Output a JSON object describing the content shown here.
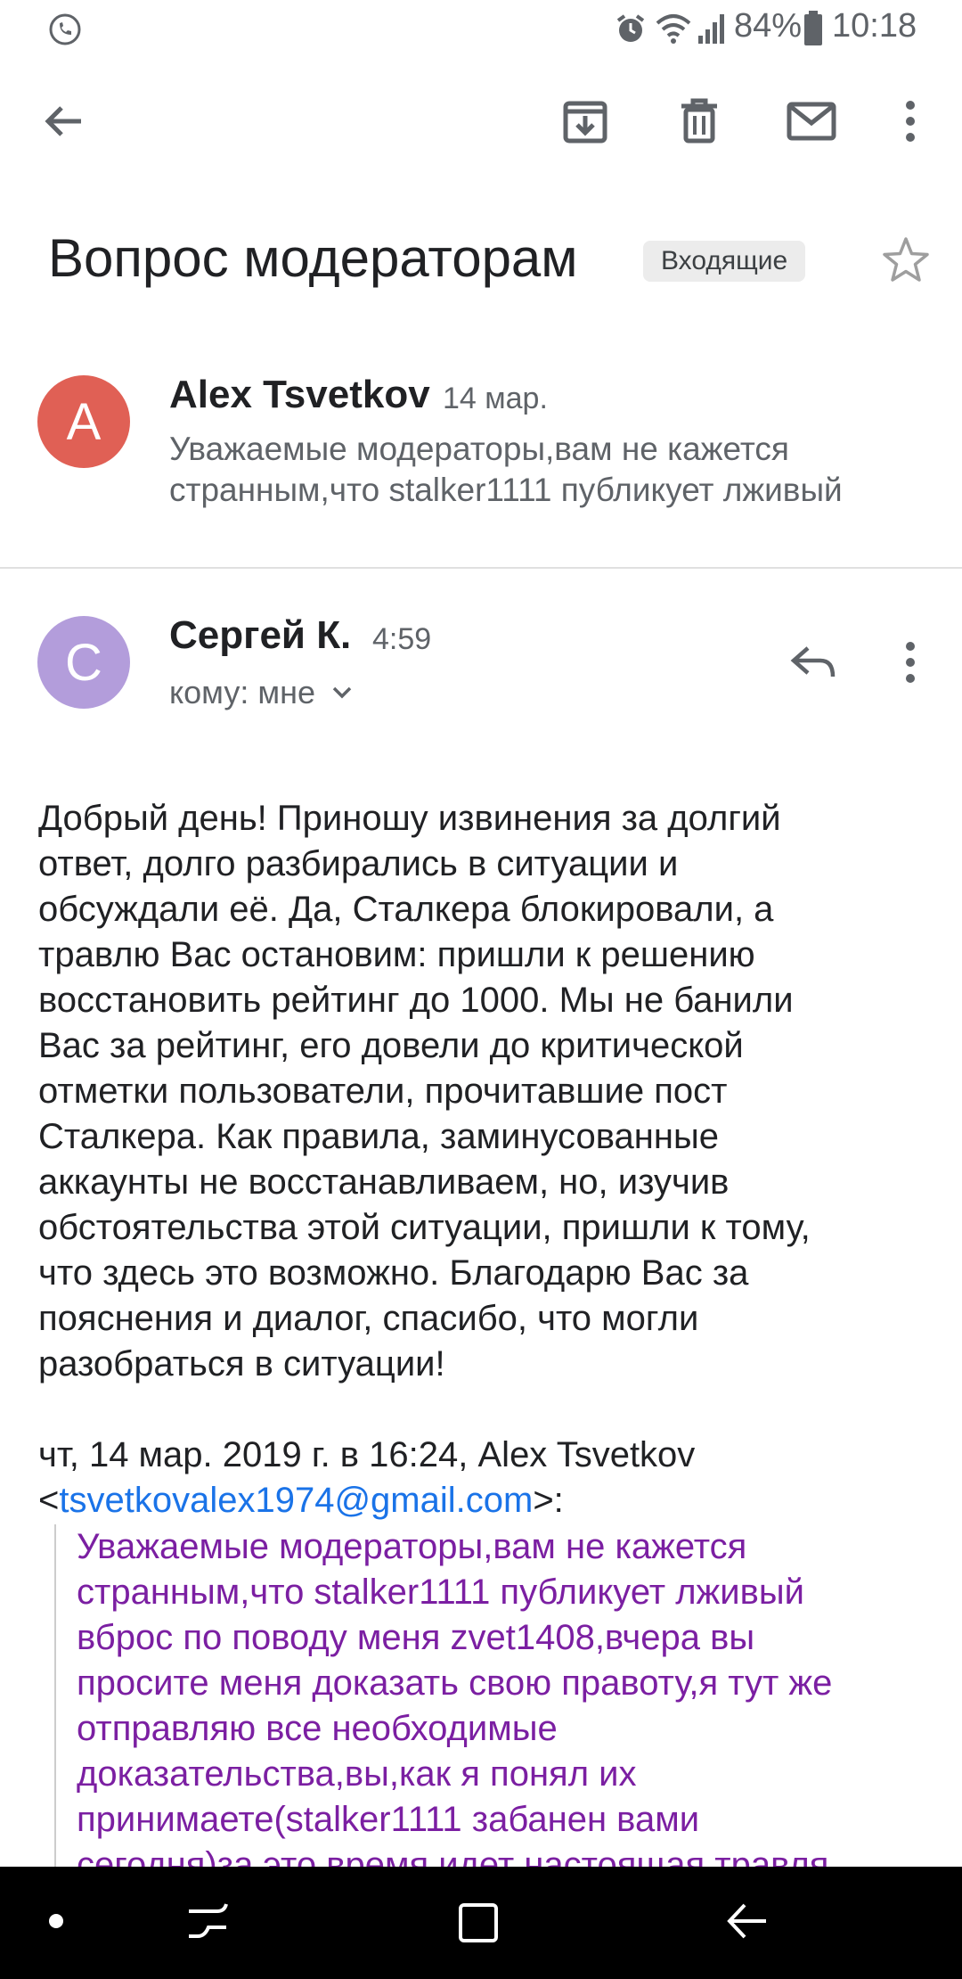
{
  "status_bar": {
    "battery": "84%",
    "time": "10:18",
    "icons": [
      "phone-call-icon",
      "alarm-icon",
      "wifi-icon",
      "signal-icon",
      "battery-icon"
    ]
  },
  "app_bar": {
    "icons": [
      "back-arrow-icon",
      "archive-icon",
      "delete-icon",
      "mark-unread-icon",
      "more-vert-icon"
    ]
  },
  "subject": {
    "title": "Вопрос модераторам",
    "label": "Входящие"
  },
  "collapsed_message": {
    "avatar_letter": "A",
    "avatar_color": "#e06055",
    "sender": "Alex Tsvetkov",
    "date": "14 мар.",
    "snippet_line1": "Уважаемые модераторы,вам не кажется",
    "snippet_line2": "странным,что stalker1111 публикует лживый"
  },
  "open_message": {
    "avatar_letter": "С",
    "avatar_color": "#b39ddb",
    "sender": "Сергей К.",
    "time": "4:59",
    "recipient": "кому: мне",
    "body_lines": [
      "Добрый день! Приношу извинения за долгий",
      "ответ, долго разбирались в ситуации и",
      "обсуждали её.  Да, Сталкера блокировали, а",
      "травлю Вас остановим: пришли к решению",
      "восстановить рейтинг до 1000.  Мы не банили",
      "Вас за рейтинг, его довели до критической",
      "отметки пользователи, прочитавшие пост",
      "Сталкера. Как правила, заминусованные",
      "аккаунты не восстанавливаем, но, изучив",
      "обстоятельства этой ситуации, пришли к тому,",
      "что здесь это возможно. Благодарю Вас за",
      "пояснения и диалог, спасибо, что могли",
      "разобраться в ситуации!"
    ],
    "quote_header_line1": "чт, 14 мар. 2019 г. в 16:24, Alex Tsvetkov",
    "quote_open": "<",
    "quote_email": "tsvetkovalex1974@gmail.com",
    "quote_close": ">:",
    "quoted_lines": [
      "Уважаемые модераторы,вам не кажется",
      "странным,что stalker1111 публикует лживый",
      "вброс по поводу меня zvet1408,вчера вы",
      "просите меня доказать свою правоту,я тут же",
      "отправляю все необходимые",
      "доказательства,вы,как я понял их",
      "принимаете(stalker1111 забанен вами",
      "сегодня)за это время идет настоящая травля"
    ]
  },
  "nav_bar": {
    "icons": [
      "dot-icon",
      "recents-icon",
      "home-icon",
      "back-icon"
    ]
  }
}
